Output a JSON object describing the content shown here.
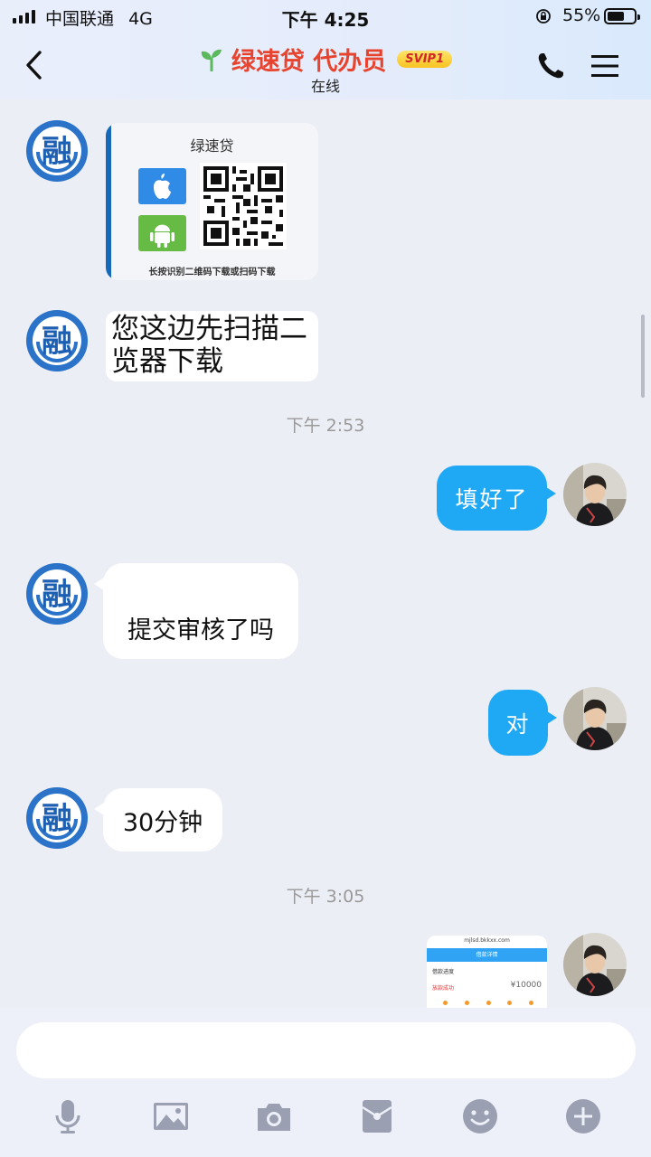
{
  "status_bar": {
    "carrier": "中国联通",
    "network": "4G",
    "time": "下午 4:25",
    "battery_percent": "55%",
    "battery_level": 0.55
  },
  "header": {
    "title": "绿速贷 代办员",
    "vip_badge": "SVIP1",
    "status": "在线",
    "title_color": "#e8432e"
  },
  "messages": {
    "qr_card": {
      "title": "绿速贷",
      "caption": "长按识别二维码下载或扫码下载"
    },
    "image_text": {
      "line1": "您这边先扫描二",
      "line2": "览器下载"
    },
    "timestamp1": "下午 2:53",
    "user_msg1": "填好了",
    "bot_msg2": "提交审核了吗",
    "user_msg2": "对",
    "bot_msg3": "30分钟",
    "timestamp2": "下午 3:05",
    "screenshot": {
      "url": "mjlsd.bkkxx.com",
      "title": "借款详情",
      "row_label": "借款进度",
      "status": "放款成功",
      "amount": "¥10000"
    }
  },
  "input": {
    "value": "",
    "placeholder": ""
  },
  "toolbar": {
    "icons": [
      "mic-icon",
      "image-icon",
      "camera-icon",
      "red-packet-icon",
      "emoji-icon",
      "plus-icon"
    ]
  },
  "colors": {
    "accent_blue": "#1fa8f4",
    "chat_background": "#eceef6"
  }
}
